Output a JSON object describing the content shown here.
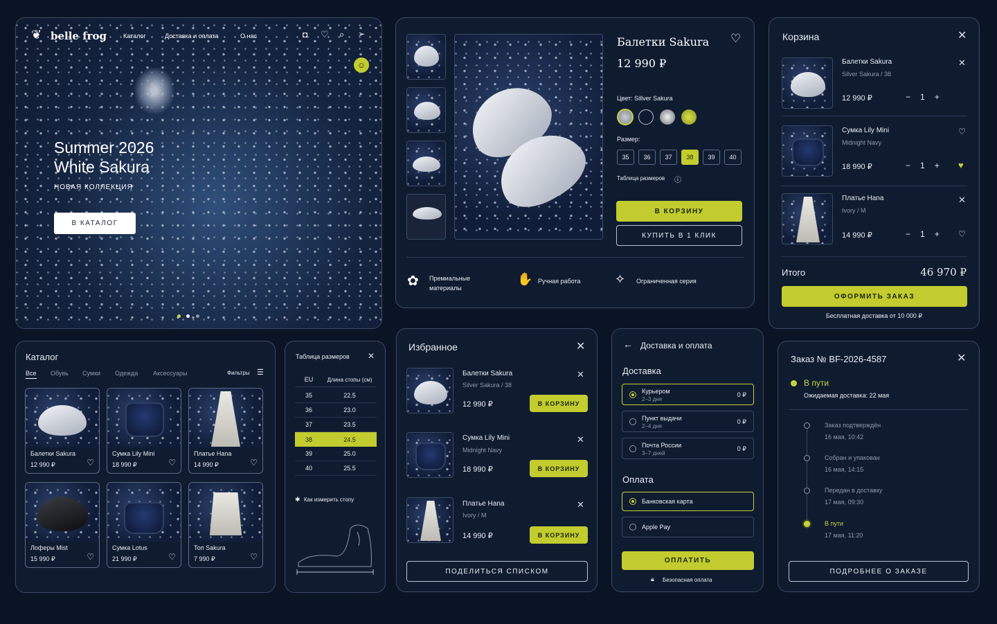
{
  "hero": {
    "brand": "belle frog",
    "nav": [
      "Каталог",
      "Доставка и оплата",
      "О нас"
    ],
    "title_line1": "Summer 2026",
    "title_line2": "White Sakura",
    "subtitle": "НОВАЯ КОЛЛЕКЦИЯ",
    "cta": "В КАТАЛОГ"
  },
  "product": {
    "name": "Балетки Sakura",
    "price": "12 990 ₽",
    "color_label": "Цвет: Sillver Sakura",
    "size_label": "Размер:",
    "sizes": [
      "35",
      "36",
      "37",
      "38",
      "39",
      "40"
    ],
    "selected_size": "38",
    "size_table_link": "Таблица размеров",
    "add_to_cart": "В КОРЗИНУ",
    "buy_one_click": "КУПИТЬ В 1 КЛИК",
    "features": [
      "Премиальные материалы",
      "Ручная работа",
      "Ограниченная серия"
    ]
  },
  "cart": {
    "title": "Корзина",
    "items": [
      {
        "name": "Балетки Sakura",
        "variant": "Silver Sakura / 38",
        "price": "12 990 ₽",
        "qty": "1"
      },
      {
        "name": "Сумка Lily Mini",
        "variant": "Midnight Navy",
        "price": "18 990 ₽",
        "qty": "1"
      },
      {
        "name": "Платье Hana",
        "variant": "Ivory / M",
        "price": "14 990 ₽",
        "qty": "1"
      }
    ],
    "total_label": "Итого",
    "total": "46 970 ₽",
    "checkout": "ОФОРМИТЬ ЗАКАЗ",
    "free_shipping": "Бесплатная доставка от 10 000 ₽"
  },
  "catalog": {
    "title": "Каталог",
    "tabs": [
      "Все",
      "Обувь",
      "Сумки",
      "Одежда",
      "Аксессуары"
    ],
    "filters": "Фильтры",
    "items": [
      {
        "name": "Балетки Sakura",
        "price": "12 990 ₽"
      },
      {
        "name": "Сумка Lily Mini",
        "price": "18 990 ₽"
      },
      {
        "name": "Платье Hana",
        "price": "14 990 ₽"
      },
      {
        "name": "Лоферы Mist",
        "price": "15 990 ₽"
      },
      {
        "name": "Сумка Lotus",
        "price": "21 990 ₽"
      },
      {
        "name": "Топ Sakura",
        "price": "7 990 ₽"
      }
    ]
  },
  "size_table": {
    "title": "Таблица размеров",
    "col_eu": "EU",
    "col_len": "Длина стопы (см)",
    "rows": [
      [
        "35",
        "22.5"
      ],
      [
        "36",
        "23.0"
      ],
      [
        "37",
        "23.5"
      ],
      [
        "38",
        "24.5"
      ],
      [
        "39",
        "25.0"
      ],
      [
        "40",
        "25.5"
      ]
    ],
    "how_to": "Как измерить стопу"
  },
  "favorites": {
    "title": "Избранное",
    "items": [
      {
        "name": "Балетки Sakura",
        "variant": "Silver Sakura / 38",
        "price": "12 990 ₽"
      },
      {
        "name": "Сумка Lily Mini",
        "variant": "Midnight Navy",
        "price": "18 990 ₽"
      },
      {
        "name": "Платье Hana",
        "variant": "Ivory / M",
        "price": "14 990 ₽"
      }
    ],
    "add_label": "В КОРЗИНУ",
    "share": "ПОДЕЛИТЬСЯ СПИСКОМ"
  },
  "delivery": {
    "title": "Доставка и оплата",
    "delivery_label": "Доставка",
    "options": [
      {
        "name": "Курьером",
        "time": "2–3 дня",
        "price": "0 ₽"
      },
      {
        "name": "Пункт выдачи",
        "time": "2–4 дня",
        "price": "0 ₽"
      },
      {
        "name": "Почта России",
        "time": "3–7 дней",
        "price": "0 ₽"
      }
    ],
    "payment_label": "Оплата",
    "payments": [
      "Банковская карта",
      "Apple Pay"
    ],
    "pay": "ОПЛАТИТЬ",
    "secure": "Безопасная оплата"
  },
  "order": {
    "title": "Заказ № BF-2026-4587",
    "status": "В пути",
    "eta": "Ожидаемая доставка: 22 мая",
    "timeline": [
      {
        "label": "Заказ подтверждён",
        "date": "16 мая, 10:42"
      },
      {
        "label": "Собран и упакован",
        "date": "16 мая, 14:15"
      },
      {
        "label": "Передан в доставку",
        "date": "17 мая, 09:30"
      },
      {
        "label": "В пути",
        "date": "17 мая, 11:20"
      }
    ],
    "details": "ПОДРОБНЕЕ О ЗАКАЗЕ"
  },
  "colors": {
    "accent": "#c6d33a",
    "bg": "#0b1424",
    "panel": "#0f1c30"
  }
}
